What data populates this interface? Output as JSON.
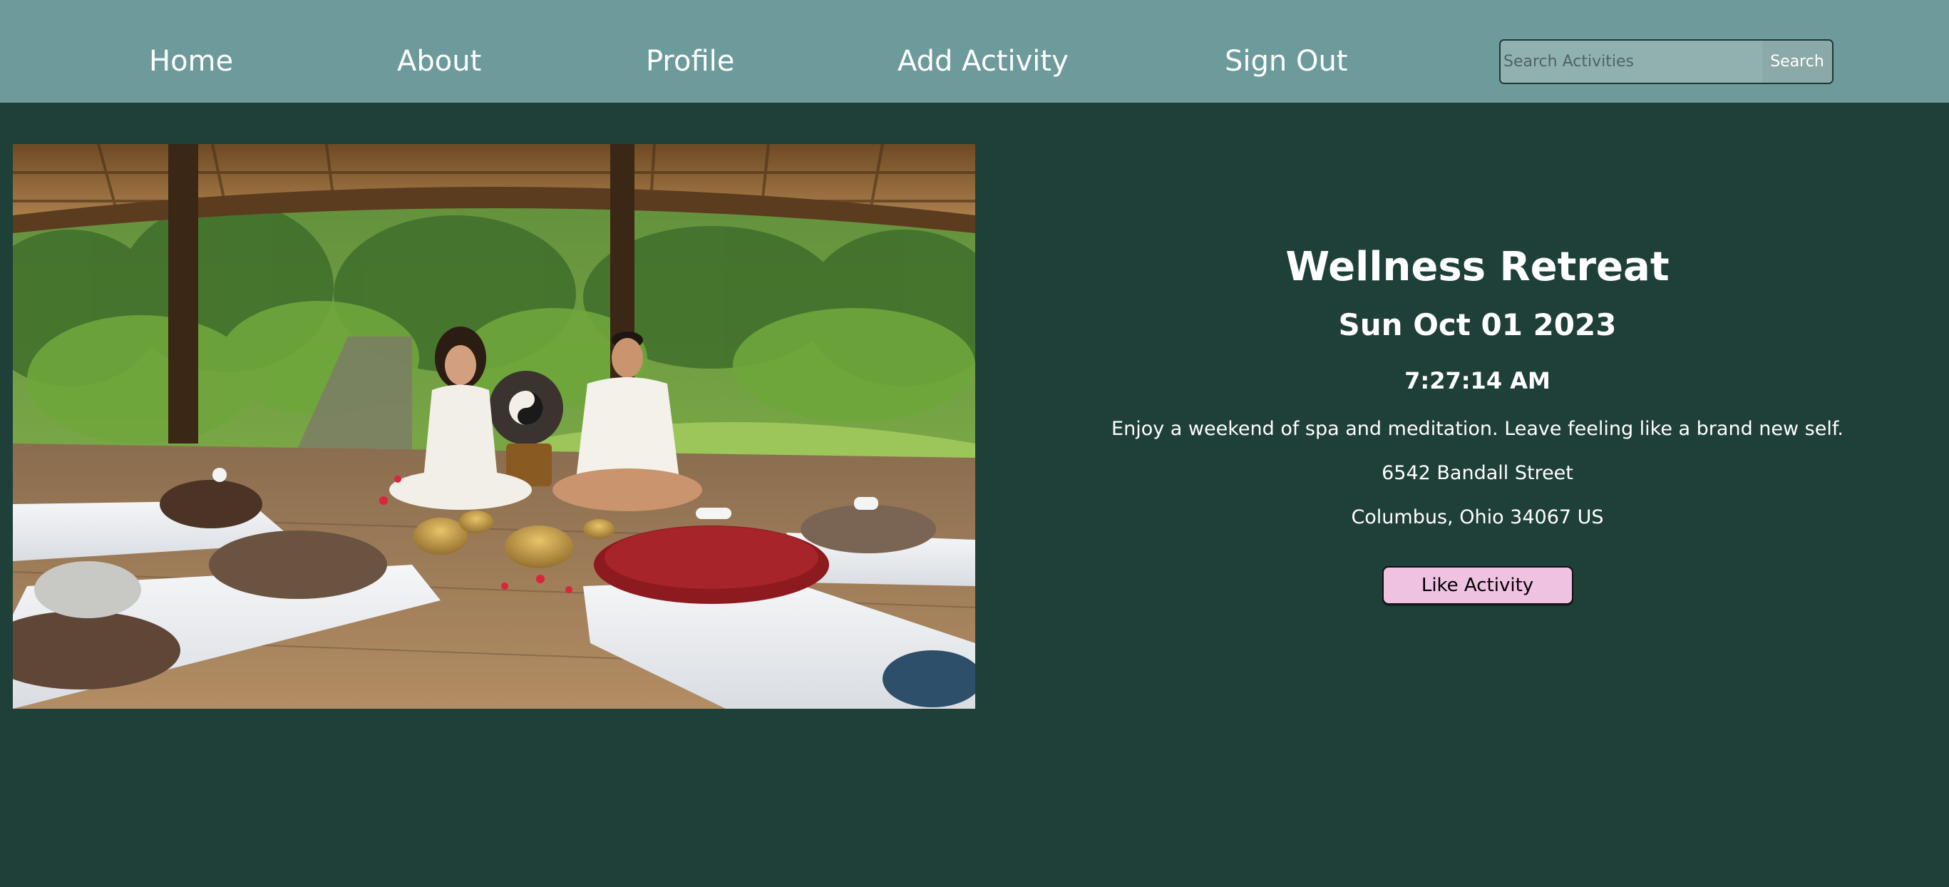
{
  "colors": {
    "page_background": "#1f3f39",
    "topbar_background": "#6d9b9c",
    "search_background": "#91b1b0",
    "like_button_background": "#f0c2e2",
    "text": "#ffffff"
  },
  "nav": {
    "items": [
      {
        "label": "Home"
      },
      {
        "label": "About"
      },
      {
        "label": "Profile"
      },
      {
        "label": "Add Activity"
      },
      {
        "label": "Sign Out"
      }
    ],
    "search": {
      "placeholder": "Search Activities",
      "value": "",
      "button_label": "Search",
      "icon": "search-field"
    }
  },
  "activity": {
    "photo": {
      "icon": "retreat-photo",
      "alt": "Two people seated in a garden pavilion with cushions and singing bowls"
    },
    "title": "Wellness Retreat",
    "date": "Sun Oct 01 2023",
    "time": "7:27:14 AM",
    "description": "Enjoy a weekend of spa and meditation. Leave feeling like a brand new self.",
    "address_line1": "6542 Bandall Street",
    "address_line2": "Columbus, Ohio 34067 US",
    "like_label": "Like Activity"
  }
}
